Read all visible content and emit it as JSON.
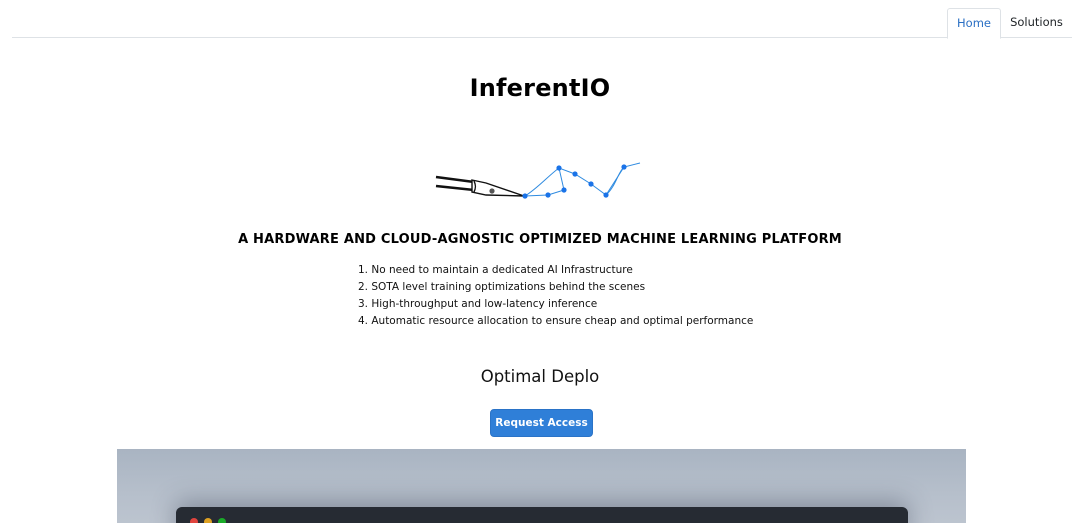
{
  "nav": {
    "tabs": [
      {
        "label": "Home",
        "active": true
      },
      {
        "label": "Solutions",
        "active": false
      }
    ]
  },
  "hero": {
    "title": "InferentIO",
    "tagline": "A HARDWARE AND CLOUD-AGNOSTIC OPTIMIZED MACHINE LEARNING PLATFORM",
    "features": [
      "1. No need to maintain a dedicated AI Infrastructure",
      "2. SOTA level training optimizations behind the scenes",
      "3. High-throughput and low-latency inference",
      "4. Automatic resource allocation to ensure cheap and optimal performance"
    ],
    "subtitle": "Optimal Deplo",
    "cta_label": "Request Access"
  },
  "colors": {
    "accent": "#2f7fd8",
    "active_tab_text": "#2a6fc4",
    "window_bg": "#262b33",
    "logo_line": "#2f8be0"
  }
}
